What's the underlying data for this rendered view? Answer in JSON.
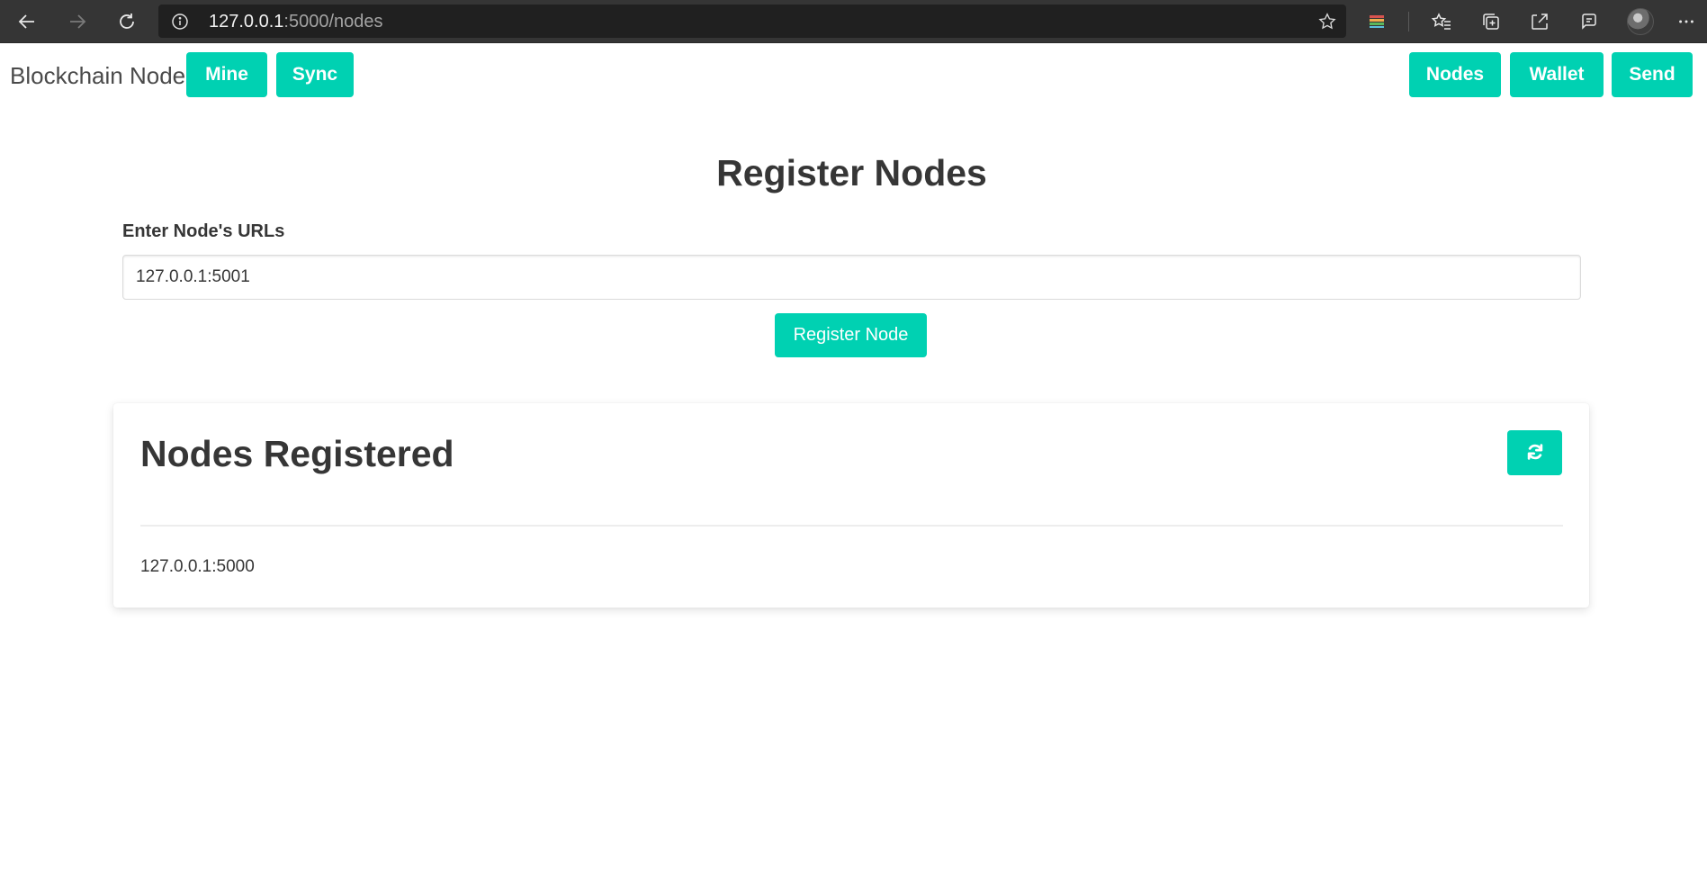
{
  "browser": {
    "url_host": "127.0.0.1",
    "url_path": ":5000/nodes",
    "icons": [
      "back-arrow-icon",
      "forward-arrow-icon",
      "refresh-icon",
      "info-icon",
      "star-icon",
      "extension-icon",
      "favorites-icon",
      "collections-icon",
      "share-icon",
      "feedback-icon",
      "more-icon"
    ]
  },
  "navbar": {
    "brand": "Blockchain Node",
    "left_buttons": [
      {
        "label": "Mine"
      },
      {
        "label": "Sync"
      }
    ],
    "right_buttons": [
      {
        "label": "Nodes"
      },
      {
        "label": "Wallet"
      },
      {
        "label": "Send"
      }
    ]
  },
  "register": {
    "title": "Register Nodes",
    "field_label": "Enter Node's URLs",
    "input_value": "127.0.0.1:5001",
    "button_label": "Register Node"
  },
  "registered": {
    "title": "Nodes Registered",
    "refresh_icon": "sync-icon",
    "nodes": [
      "127.0.0.1:5000"
    ]
  },
  "colors": {
    "primary": "#00d1b2",
    "browser_chrome": "#353535",
    "text": "#363636"
  }
}
